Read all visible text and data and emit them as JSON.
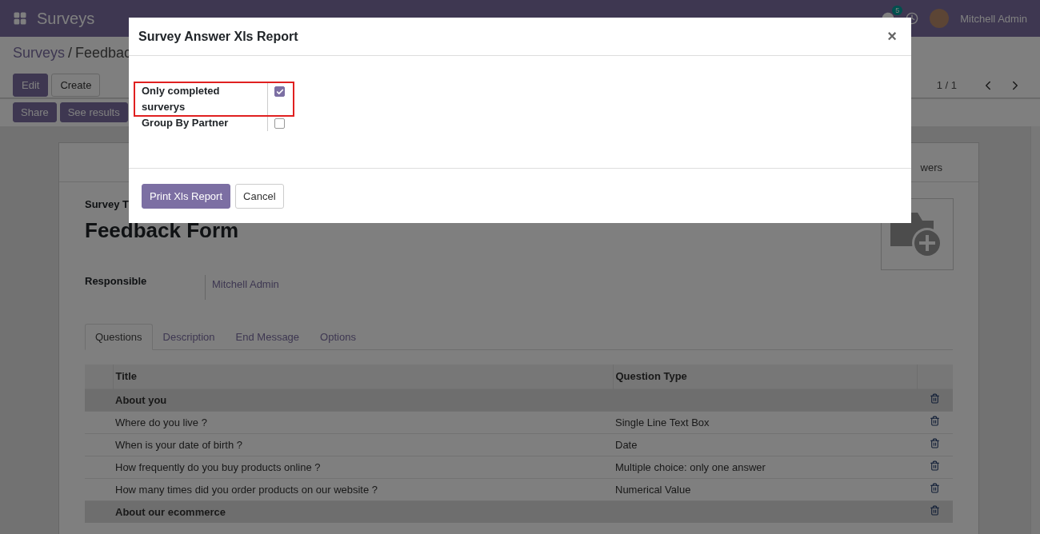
{
  "navbar": {
    "app_name": "Surveys",
    "chat_count": "5",
    "user": "Mitchell Admin"
  },
  "breadcrumb": {
    "parent": "Surveys",
    "separator": "/",
    "current": "Feedbac"
  },
  "buttons": [
    "Edit",
    "Create"
  ],
  "pager": "1 / 1",
  "actions": [
    "Share",
    "See results"
  ],
  "sheet": {
    "stat_button": "wers",
    "title_label": "Survey T",
    "title": "Feedback Form",
    "responsible_label": "Responsible",
    "responsible": "Mitchell Admin",
    "tabs": [
      {
        "label": "Questions",
        "selected": true
      },
      {
        "label": "Description",
        "selected": false
      },
      {
        "label": "End Message",
        "selected": false
      },
      {
        "label": "Options",
        "selected": false
      }
    ],
    "columns": [
      "Title",
      "Question Type"
    ],
    "rows": [
      {
        "kind": "section",
        "title": "About you",
        "type": ""
      },
      {
        "kind": "question",
        "title": "Where do you live ?",
        "type": "Single Line Text Box"
      },
      {
        "kind": "question",
        "title": "When is your date of birth ?",
        "type": "Date"
      },
      {
        "kind": "question",
        "title": "How frequently do you buy products online ?",
        "type": "Multiple choice: only one answer"
      },
      {
        "kind": "question",
        "title": "How many times did you order products on our website ?",
        "type": "Numerical Value"
      },
      {
        "kind": "section",
        "title": "About our ecommerce",
        "type": ""
      }
    ]
  },
  "dialog": {
    "title": "Survey Answer Xls Report",
    "close": "×",
    "fields": [
      {
        "label": "Only completed surverys",
        "checked": true,
        "highlighted": true
      },
      {
        "label": "Group By Partner",
        "checked": false,
        "highlighted": false
      }
    ],
    "buttons": [
      {
        "label": "Print Xls Report",
        "kind": "primary"
      },
      {
        "label": "Cancel",
        "kind": "secondary"
      }
    ]
  }
}
